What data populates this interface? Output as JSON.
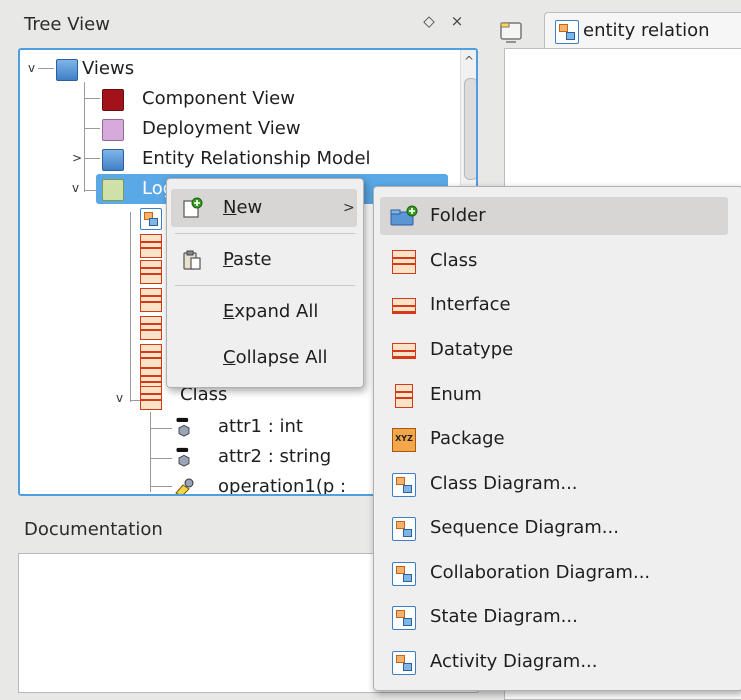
{
  "tree_dock": {
    "title": "Tree View",
    "float_glyph": "◇",
    "close_glyph": "×",
    "items": [
      {
        "label": "Views",
        "icon": "folder-blue-icon"
      },
      {
        "label": "Component View",
        "icon": "folder-red-icon"
      },
      {
        "label": "Deployment View",
        "icon": "folder-pink-icon"
      },
      {
        "label": "Entity Relationship Model",
        "icon": "folder-blue-icon"
      },
      {
        "label": "Logical View",
        "icon": "folder-green-icon"
      },
      {
        "label": "Class",
        "icon": "class-icon"
      },
      {
        "label": "attr1 : int",
        "icon": "attribute-icon"
      },
      {
        "label": "attr2 : string",
        "icon": "attribute-icon"
      },
      {
        "label": "operation1(p :",
        "icon": "operation-icon"
      }
    ]
  },
  "doc_dock": {
    "title": "Documentation"
  },
  "diagram_tab": {
    "label": "entity relation"
  },
  "context_menu": {
    "items": [
      {
        "label": "New",
        "mnemonic": "N",
        "icon": "new-icon",
        "has_submenu": true
      },
      {
        "label": "Paste",
        "mnemonic": "P",
        "icon": "paste-icon"
      },
      {
        "label": "Expand All",
        "mnemonic": "E"
      },
      {
        "label": "Collapse All",
        "mnemonic": "C"
      }
    ]
  },
  "new_submenu": {
    "items": [
      {
        "label": "Folder",
        "icon": "new-folder-icon"
      },
      {
        "label": "Class",
        "icon": "class-icon"
      },
      {
        "label": "Interface",
        "icon": "interface-icon"
      },
      {
        "label": "Datatype",
        "icon": "datatype-icon"
      },
      {
        "label": "Enum",
        "icon": "enum-icon"
      },
      {
        "label": "Package",
        "icon": "package-icon"
      },
      {
        "label": "Class Diagram...",
        "icon": "class-diagram-icon"
      },
      {
        "label": "Sequence Diagram...",
        "icon": "sequence-diagram-icon"
      },
      {
        "label": "Collaboration Diagram...",
        "icon": "collaboration-diagram-icon"
      },
      {
        "label": "State Diagram...",
        "icon": "state-diagram-icon"
      },
      {
        "label": "Activity Diagram...",
        "icon": "activity-diagram-icon"
      }
    ],
    "highlighted": "Folder"
  },
  "colors": {
    "selection": "#5aa8e6",
    "menu_highlight": "#d7d6d5",
    "focus_border": "#4e9fdc"
  }
}
